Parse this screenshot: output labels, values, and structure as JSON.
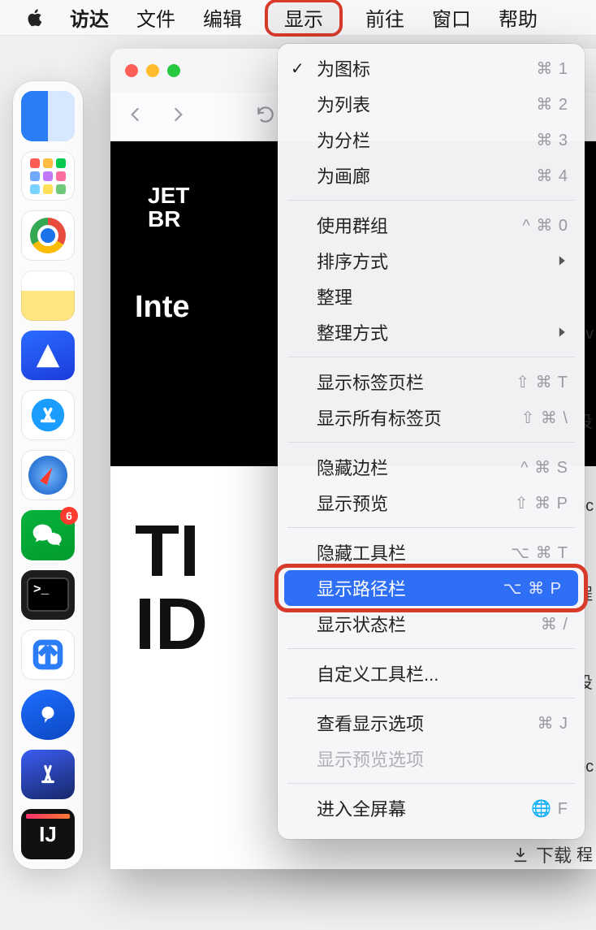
{
  "menubar": {
    "app": "访达",
    "items": [
      "文件",
      "编辑",
      "显示",
      "前往",
      "窗口",
      "帮助"
    ],
    "open_index": 2
  },
  "dropdown": {
    "groups": [
      [
        {
          "label": "为图标",
          "shortcut": "⌘ 1",
          "checked": true
        },
        {
          "label": "为列表",
          "shortcut": "⌘ 2"
        },
        {
          "label": "为分栏",
          "shortcut": "⌘ 3"
        },
        {
          "label": "为画廊",
          "shortcut": "⌘ 4"
        }
      ],
      [
        {
          "label": "使用群组",
          "shortcut": "^ ⌘ 0"
        },
        {
          "label": "排序方式",
          "submenu": true
        },
        {
          "label": "整理"
        },
        {
          "label": "整理方式",
          "submenu": true
        }
      ],
      [
        {
          "label": "显示标签页栏",
          "shortcut": "⇧ ⌘ T"
        },
        {
          "label": "显示所有标签页",
          "shortcut": "⇧ ⌘ \\"
        }
      ],
      [
        {
          "label": "隐藏边栏",
          "shortcut": "^ ⌘ S"
        },
        {
          "label": "显示预览",
          "shortcut": "⇧ ⌘ P"
        }
      ],
      [
        {
          "label": "隐藏工具栏",
          "shortcut": "⌥ ⌘ T"
        },
        {
          "label": "显示路径栏",
          "shortcut": "⌥ ⌘ P",
          "highlighted": true,
          "annotated": true
        },
        {
          "label": "显示状态栏",
          "shortcut": "⌘ /"
        }
      ],
      [
        {
          "label": "自定义工具栏..."
        }
      ],
      [
        {
          "label": "查看显示选项",
          "shortcut": "⌘ J"
        },
        {
          "label": "显示预览选项",
          "disabled": true
        }
      ],
      [
        {
          "label": "进入全屏幕",
          "shortcut": "🌐 F"
        }
      ]
    ]
  },
  "dock": {
    "wechat_badge": "6"
  },
  "window": {
    "logo_line1": "JET",
    "logo_line2": "BR",
    "hero": "Inte",
    "big_line1": "TI",
    "big_line2": "ID"
  },
  "right_sliver": [
    "ov",
    "投",
    "oc",
    "程",
    "投",
    "oc",
    "程",
    "载"
  ],
  "download_label": "下载"
}
